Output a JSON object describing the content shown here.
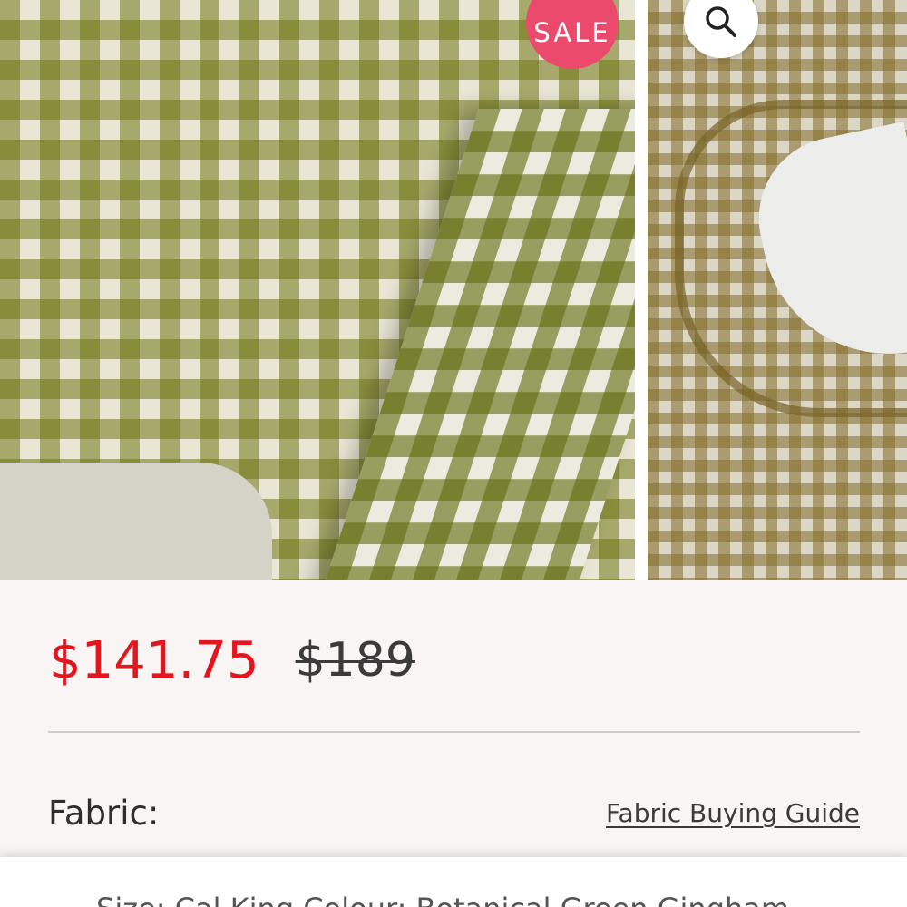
{
  "product": {
    "badge": "SALE",
    "price": {
      "sale": "$141.75",
      "original": "$189"
    },
    "fabric": {
      "label": "Fabric:",
      "guide_link": "Fabric Buying Guide"
    },
    "variant_summary": "Size: Cal King    Colour: Botanical Green Gingham"
  },
  "icons": {
    "zoom": "magnifier-icon"
  },
  "colors": {
    "sale_price": "#e3161e",
    "badge": "#ec4a6c",
    "details_bg": "#f8f5f4"
  }
}
